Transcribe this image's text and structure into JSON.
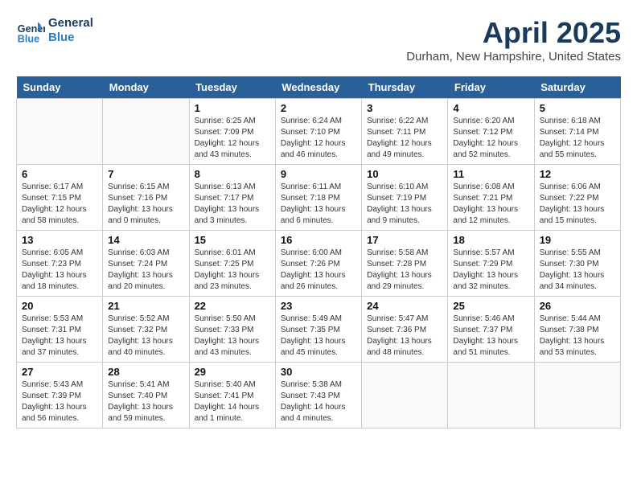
{
  "header": {
    "logo_line1": "General",
    "logo_line2": "Blue",
    "month": "April 2025",
    "location": "Durham, New Hampshire, United States"
  },
  "weekdays": [
    "Sunday",
    "Monday",
    "Tuesday",
    "Wednesday",
    "Thursday",
    "Friday",
    "Saturday"
  ],
  "weeks": [
    [
      {
        "day": "",
        "info": ""
      },
      {
        "day": "",
        "info": ""
      },
      {
        "day": "1",
        "info": "Sunrise: 6:25 AM\nSunset: 7:09 PM\nDaylight: 12 hours\nand 43 minutes."
      },
      {
        "day": "2",
        "info": "Sunrise: 6:24 AM\nSunset: 7:10 PM\nDaylight: 12 hours\nand 46 minutes."
      },
      {
        "day": "3",
        "info": "Sunrise: 6:22 AM\nSunset: 7:11 PM\nDaylight: 12 hours\nand 49 minutes."
      },
      {
        "day": "4",
        "info": "Sunrise: 6:20 AM\nSunset: 7:12 PM\nDaylight: 12 hours\nand 52 minutes."
      },
      {
        "day": "5",
        "info": "Sunrise: 6:18 AM\nSunset: 7:14 PM\nDaylight: 12 hours\nand 55 minutes."
      }
    ],
    [
      {
        "day": "6",
        "info": "Sunrise: 6:17 AM\nSunset: 7:15 PM\nDaylight: 12 hours\nand 58 minutes."
      },
      {
        "day": "7",
        "info": "Sunrise: 6:15 AM\nSunset: 7:16 PM\nDaylight: 13 hours\nand 0 minutes."
      },
      {
        "day": "8",
        "info": "Sunrise: 6:13 AM\nSunset: 7:17 PM\nDaylight: 13 hours\nand 3 minutes."
      },
      {
        "day": "9",
        "info": "Sunrise: 6:11 AM\nSunset: 7:18 PM\nDaylight: 13 hours\nand 6 minutes."
      },
      {
        "day": "10",
        "info": "Sunrise: 6:10 AM\nSunset: 7:19 PM\nDaylight: 13 hours\nand 9 minutes."
      },
      {
        "day": "11",
        "info": "Sunrise: 6:08 AM\nSunset: 7:21 PM\nDaylight: 13 hours\nand 12 minutes."
      },
      {
        "day": "12",
        "info": "Sunrise: 6:06 AM\nSunset: 7:22 PM\nDaylight: 13 hours\nand 15 minutes."
      }
    ],
    [
      {
        "day": "13",
        "info": "Sunrise: 6:05 AM\nSunset: 7:23 PM\nDaylight: 13 hours\nand 18 minutes."
      },
      {
        "day": "14",
        "info": "Sunrise: 6:03 AM\nSunset: 7:24 PM\nDaylight: 13 hours\nand 20 minutes."
      },
      {
        "day": "15",
        "info": "Sunrise: 6:01 AM\nSunset: 7:25 PM\nDaylight: 13 hours\nand 23 minutes."
      },
      {
        "day": "16",
        "info": "Sunrise: 6:00 AM\nSunset: 7:26 PM\nDaylight: 13 hours\nand 26 minutes."
      },
      {
        "day": "17",
        "info": "Sunrise: 5:58 AM\nSunset: 7:28 PM\nDaylight: 13 hours\nand 29 minutes."
      },
      {
        "day": "18",
        "info": "Sunrise: 5:57 AM\nSunset: 7:29 PM\nDaylight: 13 hours\nand 32 minutes."
      },
      {
        "day": "19",
        "info": "Sunrise: 5:55 AM\nSunset: 7:30 PM\nDaylight: 13 hours\nand 34 minutes."
      }
    ],
    [
      {
        "day": "20",
        "info": "Sunrise: 5:53 AM\nSunset: 7:31 PM\nDaylight: 13 hours\nand 37 minutes."
      },
      {
        "day": "21",
        "info": "Sunrise: 5:52 AM\nSunset: 7:32 PM\nDaylight: 13 hours\nand 40 minutes."
      },
      {
        "day": "22",
        "info": "Sunrise: 5:50 AM\nSunset: 7:33 PM\nDaylight: 13 hours\nand 43 minutes."
      },
      {
        "day": "23",
        "info": "Sunrise: 5:49 AM\nSunset: 7:35 PM\nDaylight: 13 hours\nand 45 minutes."
      },
      {
        "day": "24",
        "info": "Sunrise: 5:47 AM\nSunset: 7:36 PM\nDaylight: 13 hours\nand 48 minutes."
      },
      {
        "day": "25",
        "info": "Sunrise: 5:46 AM\nSunset: 7:37 PM\nDaylight: 13 hours\nand 51 minutes."
      },
      {
        "day": "26",
        "info": "Sunrise: 5:44 AM\nSunset: 7:38 PM\nDaylight: 13 hours\nand 53 minutes."
      }
    ],
    [
      {
        "day": "27",
        "info": "Sunrise: 5:43 AM\nSunset: 7:39 PM\nDaylight: 13 hours\nand 56 minutes."
      },
      {
        "day": "28",
        "info": "Sunrise: 5:41 AM\nSunset: 7:40 PM\nDaylight: 13 hours\nand 59 minutes."
      },
      {
        "day": "29",
        "info": "Sunrise: 5:40 AM\nSunset: 7:41 PM\nDaylight: 14 hours\nand 1 minute."
      },
      {
        "day": "30",
        "info": "Sunrise: 5:38 AM\nSunset: 7:43 PM\nDaylight: 14 hours\nand 4 minutes."
      },
      {
        "day": "",
        "info": ""
      },
      {
        "day": "",
        "info": ""
      },
      {
        "day": "",
        "info": ""
      }
    ]
  ]
}
